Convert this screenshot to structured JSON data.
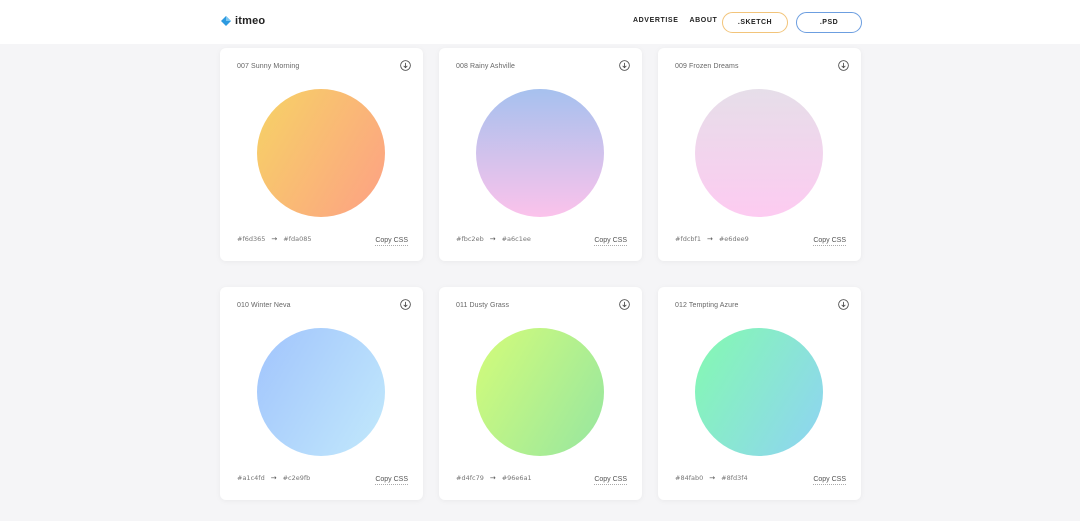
{
  "header": {
    "logo_text": "itmeo",
    "nav": [
      {
        "label": "ADVERTISE"
      },
      {
        "label": "ABOUT"
      }
    ],
    "sketch_label": ".SKETCH",
    "psd_label": ".PSD",
    "colors": {
      "sketch_border": "#f2c47a",
      "psd_border": "#6c9ee0",
      "logo": "#2d9ae0"
    }
  },
  "cards": [
    {
      "title": "007 Sunny Morning",
      "from": "#f6d365",
      "to": "#fda085",
      "copy": "Copy CSS",
      "angle": "120deg"
    },
    {
      "title": "008 Rainy Ashville",
      "from": "#fbc2eb",
      "to": "#a6c1ee",
      "copy": "Copy CSS",
      "angle": "0deg"
    },
    {
      "title": "009 Frozen Dreams",
      "from": "#fdcbf1",
      "to": "#e6dee9",
      "copy": "Copy CSS",
      "angle": "0deg"
    },
    {
      "title": "010 Winter Neva",
      "from": "#a1c4fd",
      "to": "#c2e9fb",
      "copy": "Copy CSS",
      "angle": "120deg"
    },
    {
      "title": "011 Dusty Grass",
      "from": "#d4fc79",
      "to": "#96e6a1",
      "copy": "Copy CSS",
      "angle": "120deg"
    },
    {
      "title": "012 Tempting Azure",
      "from": "#84fab0",
      "to": "#8fd3f4",
      "copy": "Copy CSS",
      "angle": "120deg"
    }
  ]
}
